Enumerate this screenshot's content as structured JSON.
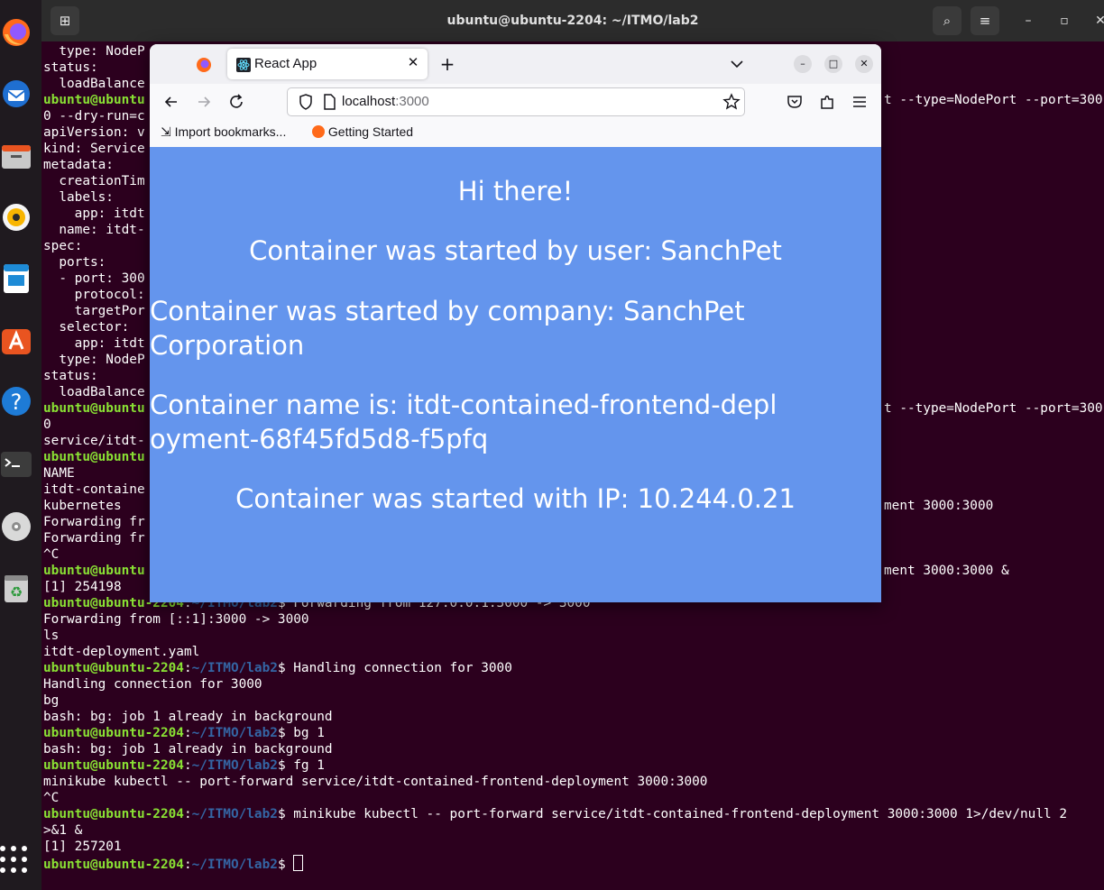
{
  "terminal": {
    "title": "ubuntu@ubuntu-2204: ~/ITMO/lab2",
    "lines": [
      {
        "text": "  type: NodeP"
      },
      {
        "text": "status:"
      },
      {
        "text": "  loadBalance"
      },
      {
        "user": "ubuntu@ubuntu",
        "path": "",
        "text": "",
        "right": "t --type=NodePort --port=300"
      },
      {
        "text": "0 --dry-run=c"
      },
      {
        "text": "apiVersion: v"
      },
      {
        "text": "kind: Service"
      },
      {
        "text": "metadata:"
      },
      {
        "text": "  creationTim"
      },
      {
        "text": "  labels:"
      },
      {
        "text": "    app: itdt"
      },
      {
        "text": "  name: itdt-"
      },
      {
        "text": "spec:"
      },
      {
        "text": "  ports:"
      },
      {
        "text": "  - port: 300"
      },
      {
        "text": "    protocol:"
      },
      {
        "text": "    targetPor"
      },
      {
        "text": "  selector:"
      },
      {
        "text": "    app: itdt"
      },
      {
        "text": "  type: NodeP"
      },
      {
        "text": "status:"
      },
      {
        "text": "  loadBalance"
      },
      {
        "user": "ubuntu@ubuntu",
        "path": "",
        "text": "",
        "right": "t --type=NodePort --port=300"
      },
      {
        "text": "0"
      },
      {
        "text": "service/itdt-"
      },
      {
        "user": "ubuntu@ubuntu",
        "path": "",
        "text": ""
      },
      {
        "text": "NAME"
      },
      {
        "text": "itdt-containe"
      },
      {
        "text": "kubernetes",
        "right": "ment 3000:3000"
      },
      {
        "text": "Forwarding fr"
      },
      {
        "text": "Forwarding fr"
      },
      {
        "text": "^C"
      },
      {
        "user": "ubuntu@ubuntu",
        "path": "",
        "text": "",
        "right": "ment 3000:3000 &"
      },
      {
        "text": "[1] 254198"
      },
      {
        "user": "ubuntu@ubuntu-2204",
        "path": "~/ITMO/lab2",
        "text": "$ Forwarding from 127.0.0.1:3000 -> 3000"
      },
      {
        "text": "Forwarding from [::1]:3000 -> 3000"
      },
      {
        "text": "ls"
      },
      {
        "text": "itdt-deployment.yaml"
      },
      {
        "user": "ubuntu@ubuntu-2204",
        "path": "~/ITMO/lab2",
        "text": "$ Handling connection for 3000"
      },
      {
        "text": "Handling connection for 3000"
      },
      {
        "text": "bg"
      },
      {
        "text": "bash: bg: job 1 already in background"
      },
      {
        "user": "ubuntu@ubuntu-2204",
        "path": "~/ITMO/lab2",
        "text": "$ bg 1"
      },
      {
        "text": "bash: bg: job 1 already in background"
      },
      {
        "user": "ubuntu@ubuntu-2204",
        "path": "~/ITMO/lab2",
        "text": "$ fg 1"
      },
      {
        "text": "minikube kubectl -- port-forward service/itdt-contained-frontend-deployment 3000:3000"
      },
      {
        "text": "^C"
      },
      {
        "user": "ubuntu@ubuntu-2204",
        "path": "~/ITMO/lab2",
        "text": "$ minikube kubectl -- port-forward service/itdt-contained-frontend-deployment 3000:3000 1>/dev/null 2"
      },
      {
        "text": ">&1 &"
      },
      {
        "text": "[1] 257201"
      },
      {
        "user": "ubuntu@ubuntu-2204",
        "path": "~/ITMO/lab2",
        "text": "$ ",
        "cursor": true
      }
    ]
  },
  "browser": {
    "tab_title": "React App",
    "url_host": "localhost",
    "url_port": ":3000",
    "bookmarks": [
      "Import bookmarks...",
      "Getting Started"
    ],
    "page": {
      "greeting": "Hi there!",
      "user_line": "Container was started by user: SanchPet",
      "company_line": "Container was started by company: SanchPet Corporation",
      "name_line": "Container name is: itdt-contained-frontend-deployment-68f45fd5d8-f5pfq",
      "ip_line": "Container was started with IP: 10.244.0.21"
    }
  },
  "dock": [
    "firefox",
    "thunderbird",
    "files",
    "rhythmbox",
    "writer",
    "app-center",
    "help",
    "terminal",
    "optical-drive",
    "trash",
    "show-apps"
  ]
}
